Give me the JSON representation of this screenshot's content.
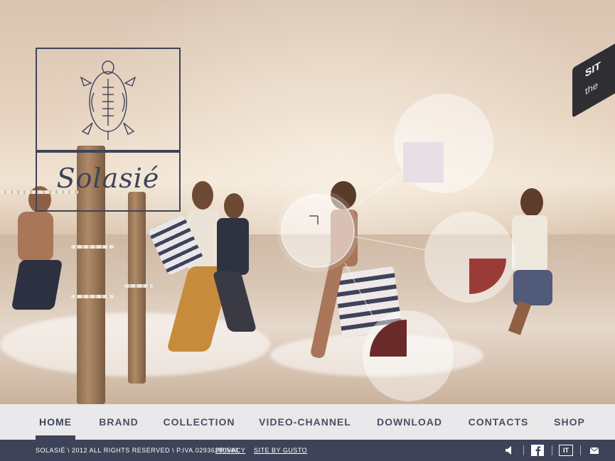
{
  "brand": {
    "name": "Solasié",
    "logo_icon": "turtle-icon"
  },
  "ribbon": {
    "label": "SIT",
    "sub": "the"
  },
  "nav": {
    "items": [
      {
        "label": "HOME",
        "active": true
      },
      {
        "label": "BRAND"
      },
      {
        "label": "COLLECTION"
      },
      {
        "label": "VIDEO-CHANNEL"
      },
      {
        "label": "DOWNLOAD"
      },
      {
        "label": "CONTACTS"
      },
      {
        "label": "SHOP"
      }
    ]
  },
  "footer": {
    "copyright": "SOLASIÉ \\ 2012 ALL RIGHTS RESERVED \\ P.IVA.02936280540",
    "privacy": "PRIVACY",
    "site_by": "SITE BY GUSTO",
    "icons": [
      "speaker-icon",
      "facebook-icon",
      "language-it-icon",
      "mail-icon"
    ],
    "lang_label": "IT"
  },
  "hotspots": {
    "colors": [
      "#e6e0e6",
      "#9b3b36",
      "#6b2a2a"
    ]
  }
}
